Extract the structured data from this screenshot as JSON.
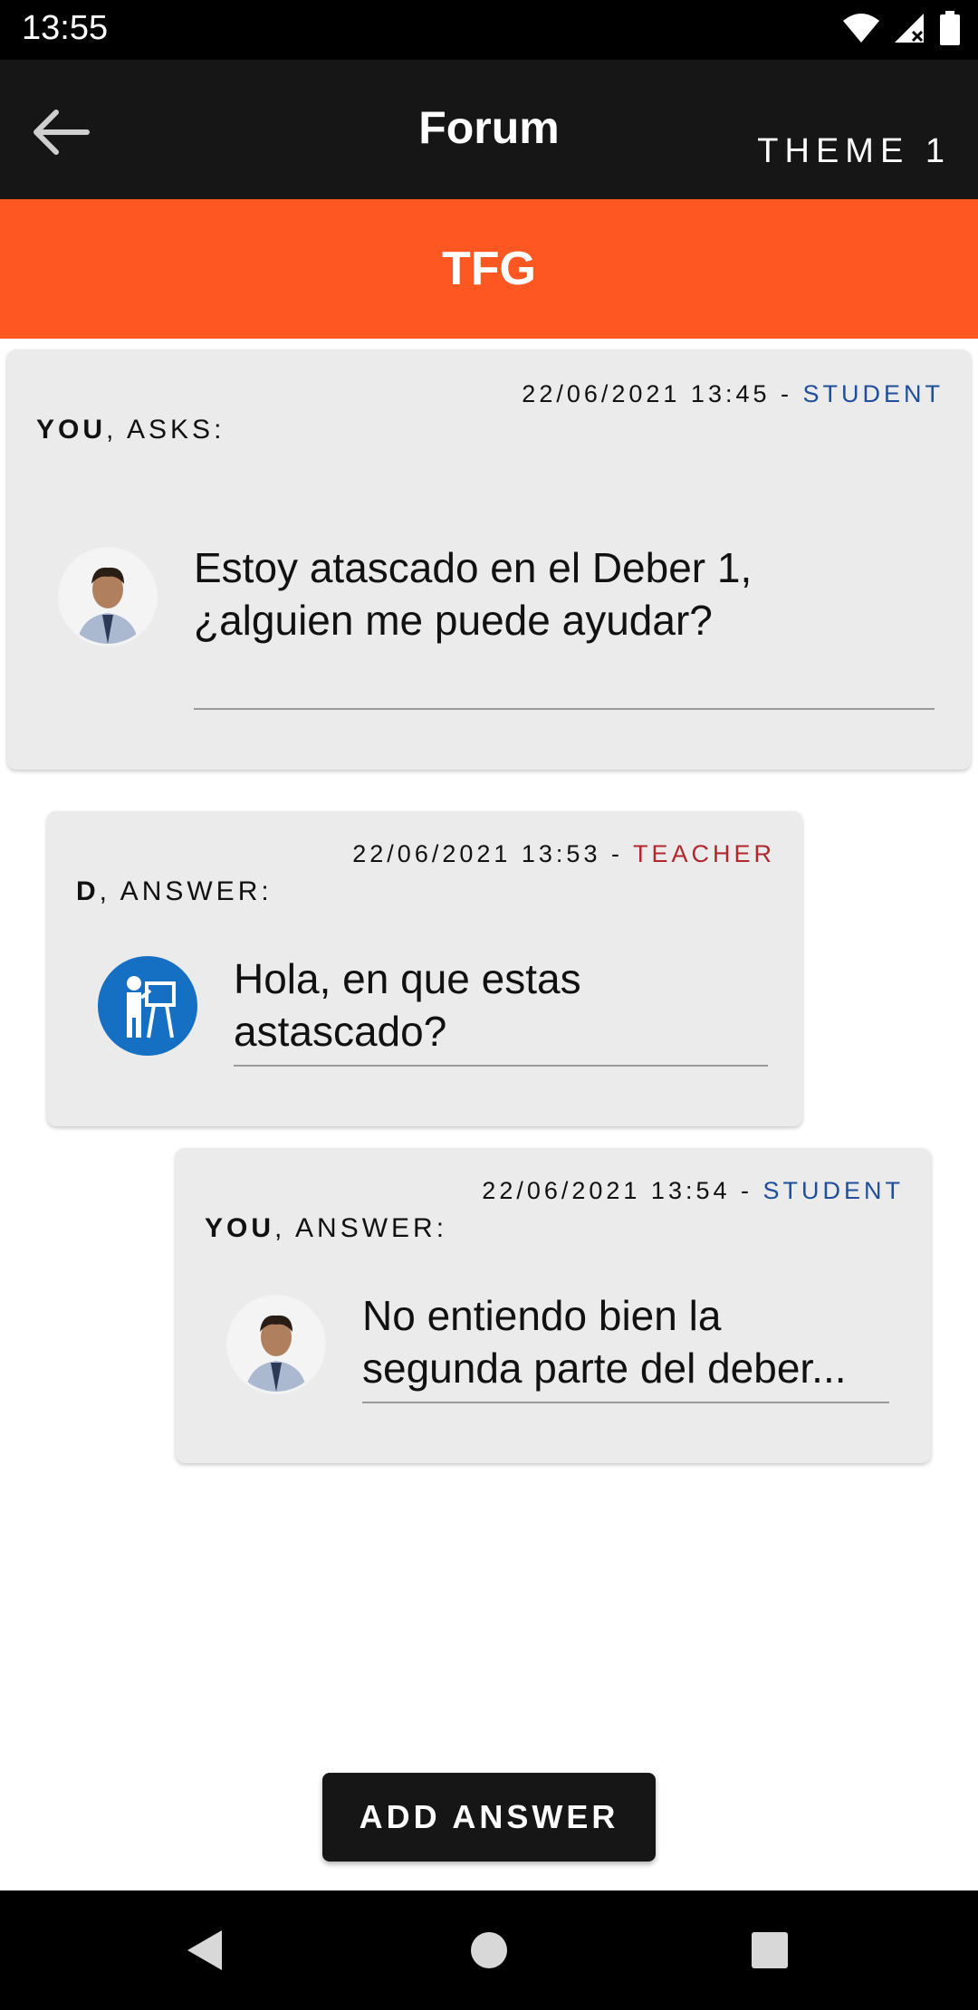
{
  "status_bar": {
    "time": "13:55"
  },
  "app_bar": {
    "title": "Forum",
    "theme_label": "THEME 1"
  },
  "banner": {
    "course": "TFG"
  },
  "posts": [
    {
      "timestamp": "22/06/2021 13:45 - ",
      "role": "STUDENT",
      "author": "YOU",
      "action": ", ASKS:",
      "text_line1": "Estoy atascado en el Deber 1,",
      "text_line2": "¿alguien me puede ayudar?"
    },
    {
      "timestamp": "22/06/2021 13:53 - ",
      "role": "TEACHER",
      "author": "D",
      "action": ", ANSWER:",
      "text_line1": "Hola, en que estas",
      "text_line2": "astascado?"
    },
    {
      "timestamp": "22/06/2021 13:54 - ",
      "role": "STUDENT",
      "author": "YOU",
      "action": ", ANSWER:",
      "text_line1": "No entiendo bien la",
      "text_line2": "segunda parte del deber..."
    }
  ],
  "actions": {
    "add_answer": "ADD ANSWER"
  },
  "colors": {
    "accent": "#ff5722",
    "app_bar": "#161616",
    "student": "#1f4e9a",
    "teacher": "#b0282c"
  }
}
